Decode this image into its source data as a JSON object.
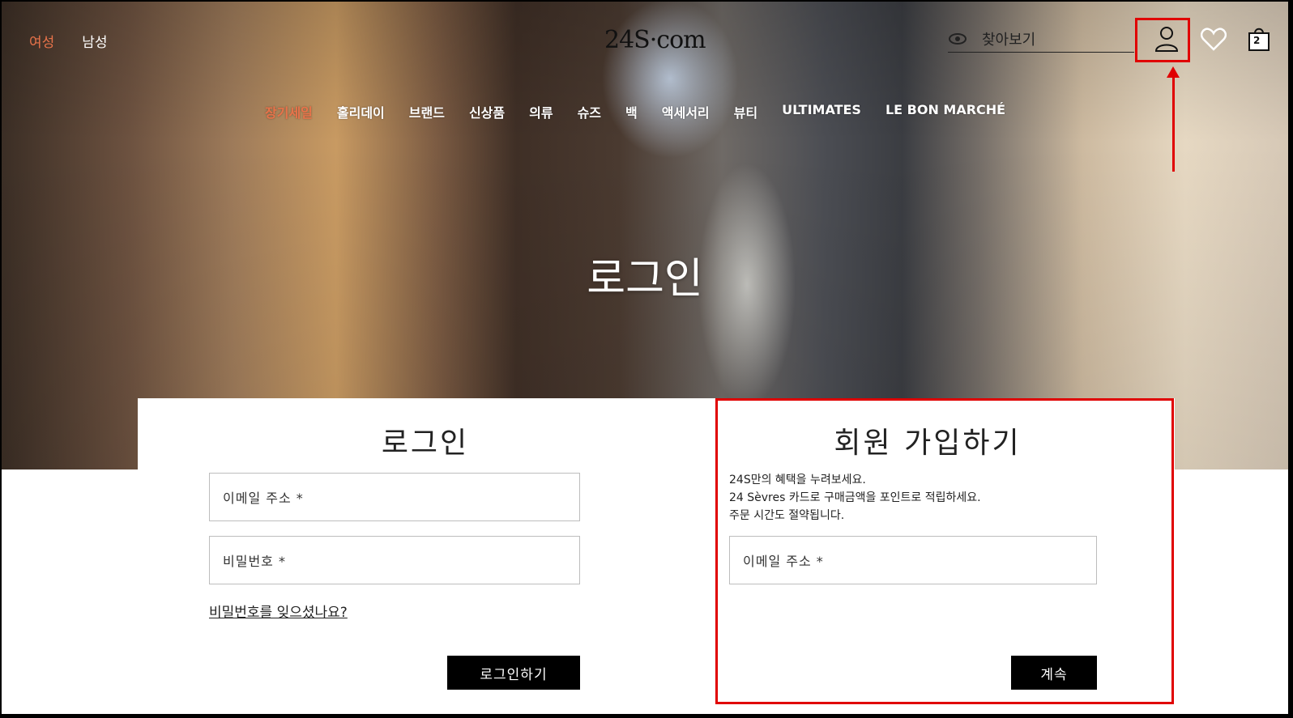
{
  "header": {
    "gender_tabs": [
      "여성",
      "남성"
    ],
    "logo": "24S·com",
    "search_placeholder": "찾아보기",
    "icons": {
      "search": "eye-icon",
      "account": "user-icon",
      "wishlist": "heart-icon",
      "bag": "bag-icon",
      "bag_count": "2"
    }
  },
  "menu": {
    "items": [
      "장기세일",
      "홀리데이",
      "브랜드",
      "신상품",
      "의류",
      "슈즈",
      "백",
      "액세서리",
      "뷰티",
      "ULTIMATES",
      "LE BON MARCHÉ"
    ]
  },
  "hero": {
    "title": "로그인"
  },
  "login": {
    "title": "로그인",
    "email_label": "이메일 주소 *",
    "password_label": "비밀번호 *",
    "forgot_link": "비밀번호를 잊으셨나요?",
    "submit": "로그인하기"
  },
  "signup": {
    "title": "회원 가입하기",
    "description": [
      "24S만의 혜택을 누려보세요.",
      "24 Sèvres 카드로 구매금액을 포인트로 적립하세요.",
      "주문 시간도 절약됩니다."
    ],
    "email_label": "이메일 주소 *",
    "submit": "계속"
  },
  "colors": {
    "accent": "#e8734a",
    "annotation_red": "#e00000",
    "button_black": "#000000"
  }
}
